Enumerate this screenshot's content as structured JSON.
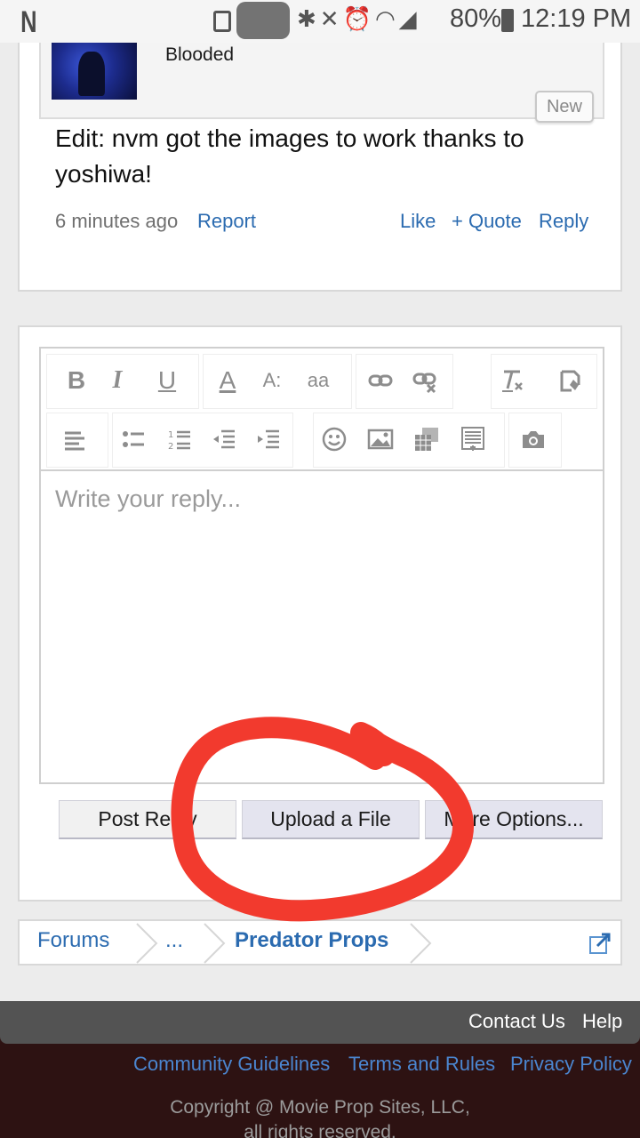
{
  "status_bar": {
    "battery": "80%",
    "time": "12:19 PM",
    "icons": [
      "n-icon",
      "lock-icon",
      "bluetooth-icon",
      "mute-icon",
      "alarm-icon",
      "wifi-icon",
      "signal-icon",
      "battery-icon"
    ]
  },
  "post": {
    "quote_text": "Blooded",
    "new_badge": "New",
    "body": "Edit: nvm got the images to work thanks to yoshiwa!",
    "time": "6 minutes ago",
    "report": "Report",
    "like": "Like",
    "quote": "+ Quote",
    "reply": "Reply"
  },
  "editor": {
    "placeholder": "Write your reply...",
    "toolbar_row1": [
      "B",
      "I",
      "U",
      "A",
      "A:",
      "aa"
    ],
    "toolbar_icons": [
      "bold-icon",
      "italic-icon",
      "underline-icon",
      "font-color-icon",
      "font-size-icon",
      "font-family-icon",
      "link-icon",
      "unlink-icon",
      "remove-format-icon",
      "undo-icon",
      "align-left-icon",
      "bulleted-list-icon",
      "numbered-list-icon",
      "outdent-icon",
      "indent-icon",
      "smiley-icon",
      "image-icon",
      "media-icon",
      "code-icon",
      "camera-icon"
    ]
  },
  "buttons": {
    "post_reply": "Post Reply",
    "upload": "Upload a File",
    "more_options": "More Options..."
  },
  "breadcrumb": {
    "forums": "Forums",
    "ellipsis": "...",
    "current": "Predator Props"
  },
  "footer": {
    "contact": "Contact Us",
    "help": "Help",
    "guidelines": "Community Guidelines",
    "terms": "Terms and Rules",
    "privacy": "Privacy Policy",
    "copyright_line1": "Copyright @ Movie Prop Sites, LLC,",
    "copyright_line2": "all rights reserved."
  },
  "colors": {
    "link": "#2b6bb0",
    "annotation": "#f23a2e",
    "footer_dark": "#535353",
    "footer_red": "#2d1212"
  }
}
